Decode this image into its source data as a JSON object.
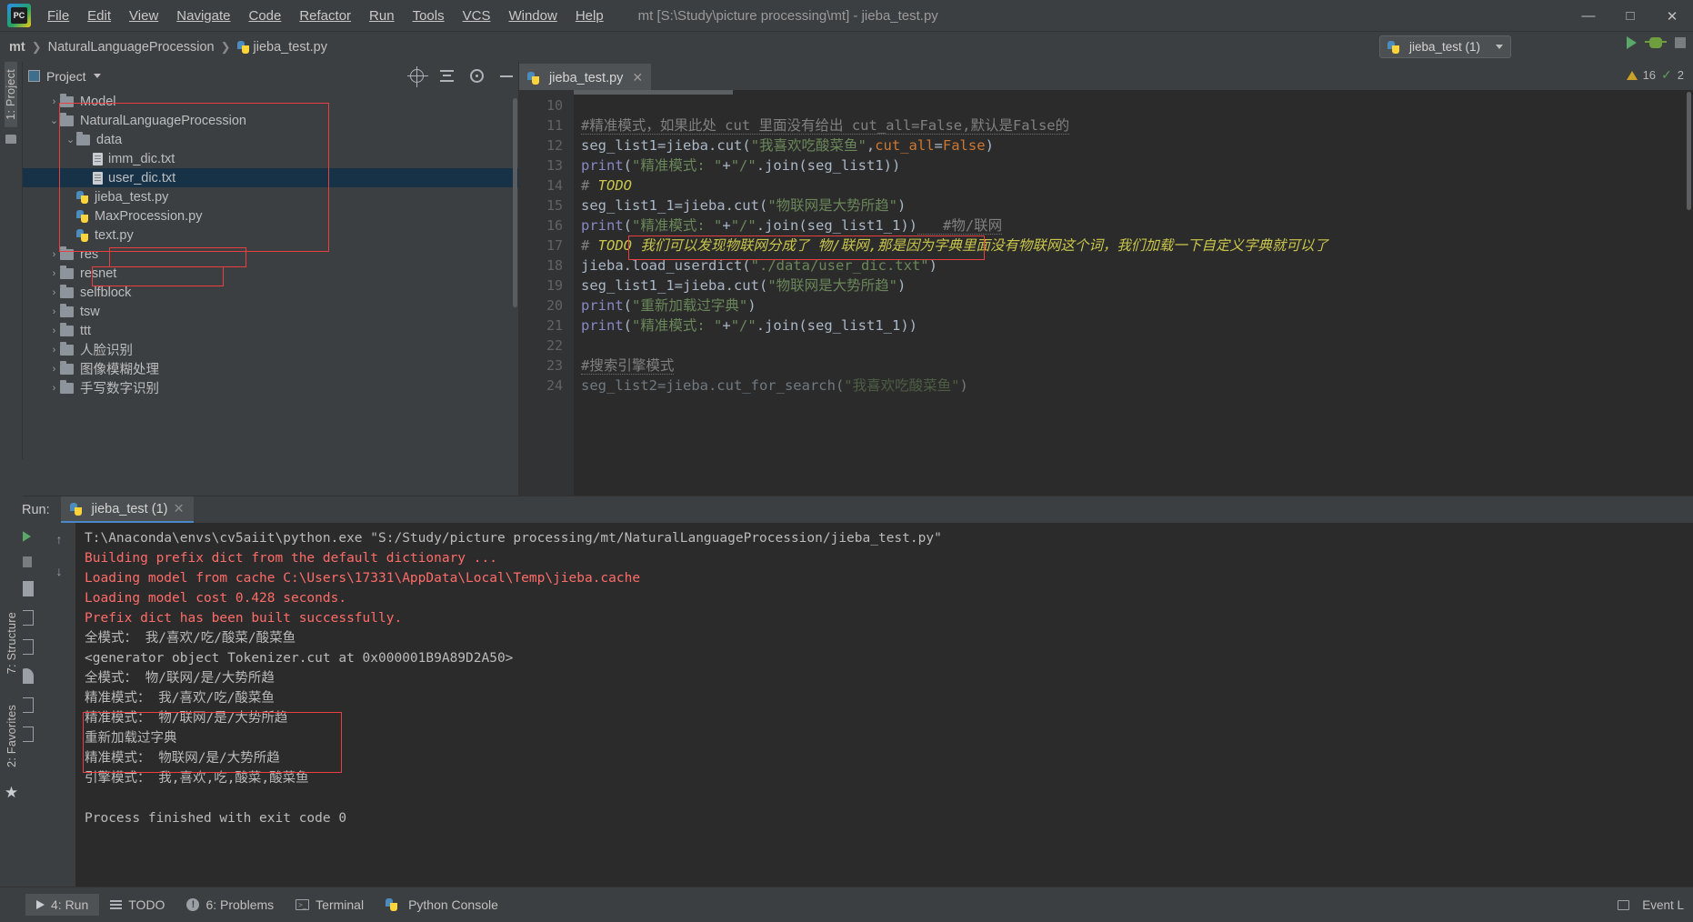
{
  "window": {
    "title": "mt [S:\\Study\\picture processing\\mt] - jieba_test.py",
    "minimize": "—",
    "maximize": "□",
    "close": "✕"
  },
  "menu": {
    "items": [
      "File",
      "Edit",
      "View",
      "Navigate",
      "Code",
      "Refactor",
      "Run",
      "Tools",
      "VCS",
      "Window",
      "Help"
    ]
  },
  "breadcrumb": {
    "items": [
      "mt",
      "NaturalLanguageProcession",
      "jieba_test.py"
    ]
  },
  "run_config": {
    "name": "jieba_test (1)"
  },
  "left_stripe": {
    "project_tab": "1: Project"
  },
  "right_stripe": {
    "structure_tab": "7: Structure",
    "favorites_tab": "2: Favorites"
  },
  "project_panel": {
    "title": "Project",
    "tree": [
      {
        "label": "Model",
        "type": "folder",
        "depth": 1,
        "arrow": "›",
        "selected": false
      },
      {
        "label": "NaturalLanguageProcession",
        "type": "folder",
        "depth": 1,
        "arrow": "⌄",
        "selected": false
      },
      {
        "label": "data",
        "type": "folder",
        "depth": 2,
        "arrow": "⌄",
        "selected": false
      },
      {
        "label": "imm_dic.txt",
        "type": "txt",
        "depth": 3,
        "arrow": "",
        "selected": false
      },
      {
        "label": "user_dic.txt",
        "type": "txt",
        "depth": 3,
        "arrow": "",
        "selected": true
      },
      {
        "label": "jieba_test.py",
        "type": "py",
        "depth": 2,
        "arrow": "",
        "selected": false
      },
      {
        "label": "MaxProcession.py",
        "type": "py",
        "depth": 2,
        "arrow": "",
        "selected": false
      },
      {
        "label": "text.py",
        "type": "py",
        "depth": 2,
        "arrow": "",
        "selected": false
      },
      {
        "label": "res",
        "type": "folder",
        "depth": 1,
        "arrow": "›",
        "selected": false
      },
      {
        "label": "resnet",
        "type": "folder",
        "depth": 1,
        "arrow": "›",
        "selected": false
      },
      {
        "label": "selfblock",
        "type": "folder",
        "depth": 1,
        "arrow": "›",
        "selected": false
      },
      {
        "label": "tsw",
        "type": "folder",
        "depth": 1,
        "arrow": "›",
        "selected": false
      },
      {
        "label": "ttt",
        "type": "folder",
        "depth": 1,
        "arrow": "›",
        "selected": false
      },
      {
        "label": "人脸识别",
        "type": "folder",
        "depth": 1,
        "arrow": "›",
        "selected": false
      },
      {
        "label": "图像模糊处理",
        "type": "folder",
        "depth": 1,
        "arrow": "›",
        "selected": false
      },
      {
        "label": "手写数字识别",
        "type": "folder",
        "depth": 1,
        "arrow": "›",
        "selected": false
      }
    ]
  },
  "editor": {
    "tab": {
      "label": "jieba_test.py",
      "close": "✕"
    },
    "inspection": {
      "warnings": "16",
      "check": "✓",
      "count": "2"
    },
    "first_line_number": 10,
    "lines": [
      {
        "n": 10,
        "text": ""
      },
      {
        "n": 11,
        "text": "#精准模式，如果此处  cut  里面没有给出  cut_all=False,默认是False的"
      },
      {
        "n": 12,
        "text": "seg_list1=jieba.cut(\"我喜欢吃酸菜鱼\",cut_all=False)"
      },
      {
        "n": 13,
        "text": "print(\"精准模式:    \"+\"/\".join(seg_list1))"
      },
      {
        "n": 14,
        "text": "# TODO"
      },
      {
        "n": 15,
        "text": "seg_list1_1=jieba.cut(\"物联网是大势所趋\")"
      },
      {
        "n": 16,
        "text": "print(\"精准模式:    \"+\"/\".join(seg_list1_1))   #物/联网"
      },
      {
        "n": 17,
        "text": "# TODO 我们可以发现物联网分成了   物/联网,那是因为字典里面没有物联网这个词，我们加载一下自定义字典就可以了"
      },
      {
        "n": 18,
        "text": "jieba.load_userdict(\"./data/user_dic.txt\")"
      },
      {
        "n": 19,
        "text": "seg_list1_1=jieba.cut(\"物联网是大势所趋\")"
      },
      {
        "n": 20,
        "text": "print(\"重新加载过字典\")"
      },
      {
        "n": 21,
        "text": "print(\"精准模式:    \"+\"/\".join(seg_list1_1))"
      },
      {
        "n": 22,
        "text": ""
      },
      {
        "n": 23,
        "text": "#搜索引擎模式"
      },
      {
        "n": 24,
        "text": "seg_list2=jieba.cut_for_search(\"我喜欢吃酸菜鱼\")"
      }
    ]
  },
  "run_panel": {
    "label": "Run:",
    "tab": "jieba_test (1)",
    "tab_close": "✕",
    "console": [
      {
        "text": "T:\\Anaconda\\envs\\cv5aiit\\python.exe \"S:/Study/picture processing/mt/NaturalLanguageProcession/jieba_test.py\"",
        "color": "white"
      },
      {
        "text": "Building prefix dict from the default dictionary ...",
        "color": "red"
      },
      {
        "text": "Loading model from cache C:\\Users\\17331\\AppData\\Local\\Temp\\jieba.cache",
        "color": "red"
      },
      {
        "text": "Loading model cost 0.428 seconds.",
        "color": "red"
      },
      {
        "text": "Prefix dict has been built successfully.",
        "color": "red"
      },
      {
        "text": "全模式：    我/喜欢/吃/酸菜/酸菜鱼",
        "color": "white"
      },
      {
        "text": "<generator object Tokenizer.cut at 0x000001B9A89D2A50>",
        "color": "white"
      },
      {
        "text": "全模式：    物/联网/是/大势所趋",
        "color": "white"
      },
      {
        "text": "精准模式：    我/喜欢/吃/酸菜鱼",
        "color": "white"
      },
      {
        "text": "精准模式：    物/联网/是/大势所趋",
        "color": "white"
      },
      {
        "text": "重新加载过字典",
        "color": "white"
      },
      {
        "text": "精准模式：    物联网/是/大势所趋",
        "color": "white"
      },
      {
        "text": "引擎模式：    我,喜欢,吃,酸菜,酸菜鱼",
        "color": "white"
      },
      {
        "text": "",
        "color": "white"
      },
      {
        "text": "Process finished with exit code 0",
        "color": "white"
      }
    ]
  },
  "status_bar": {
    "items": [
      {
        "label": "4: Run",
        "icon": "run-icon",
        "active": true
      },
      {
        "label": "TODO",
        "icon": "todo-icon",
        "active": false
      },
      {
        "label": "6: Problems",
        "icon": "problems-icon",
        "active": false
      },
      {
        "label": "Terminal",
        "icon": "terminal-icon",
        "active": false
      },
      {
        "label": "Python Console",
        "icon": "python-icon",
        "active": false
      }
    ],
    "right": {
      "event_log": "Event L"
    }
  },
  "colors": {
    "accent": "#4a88c7",
    "highlight_box": "#e84040",
    "selection": "#173247",
    "error_text": "#ff6b68",
    "string": "#6a8759",
    "keyword": "#cc7832"
  }
}
